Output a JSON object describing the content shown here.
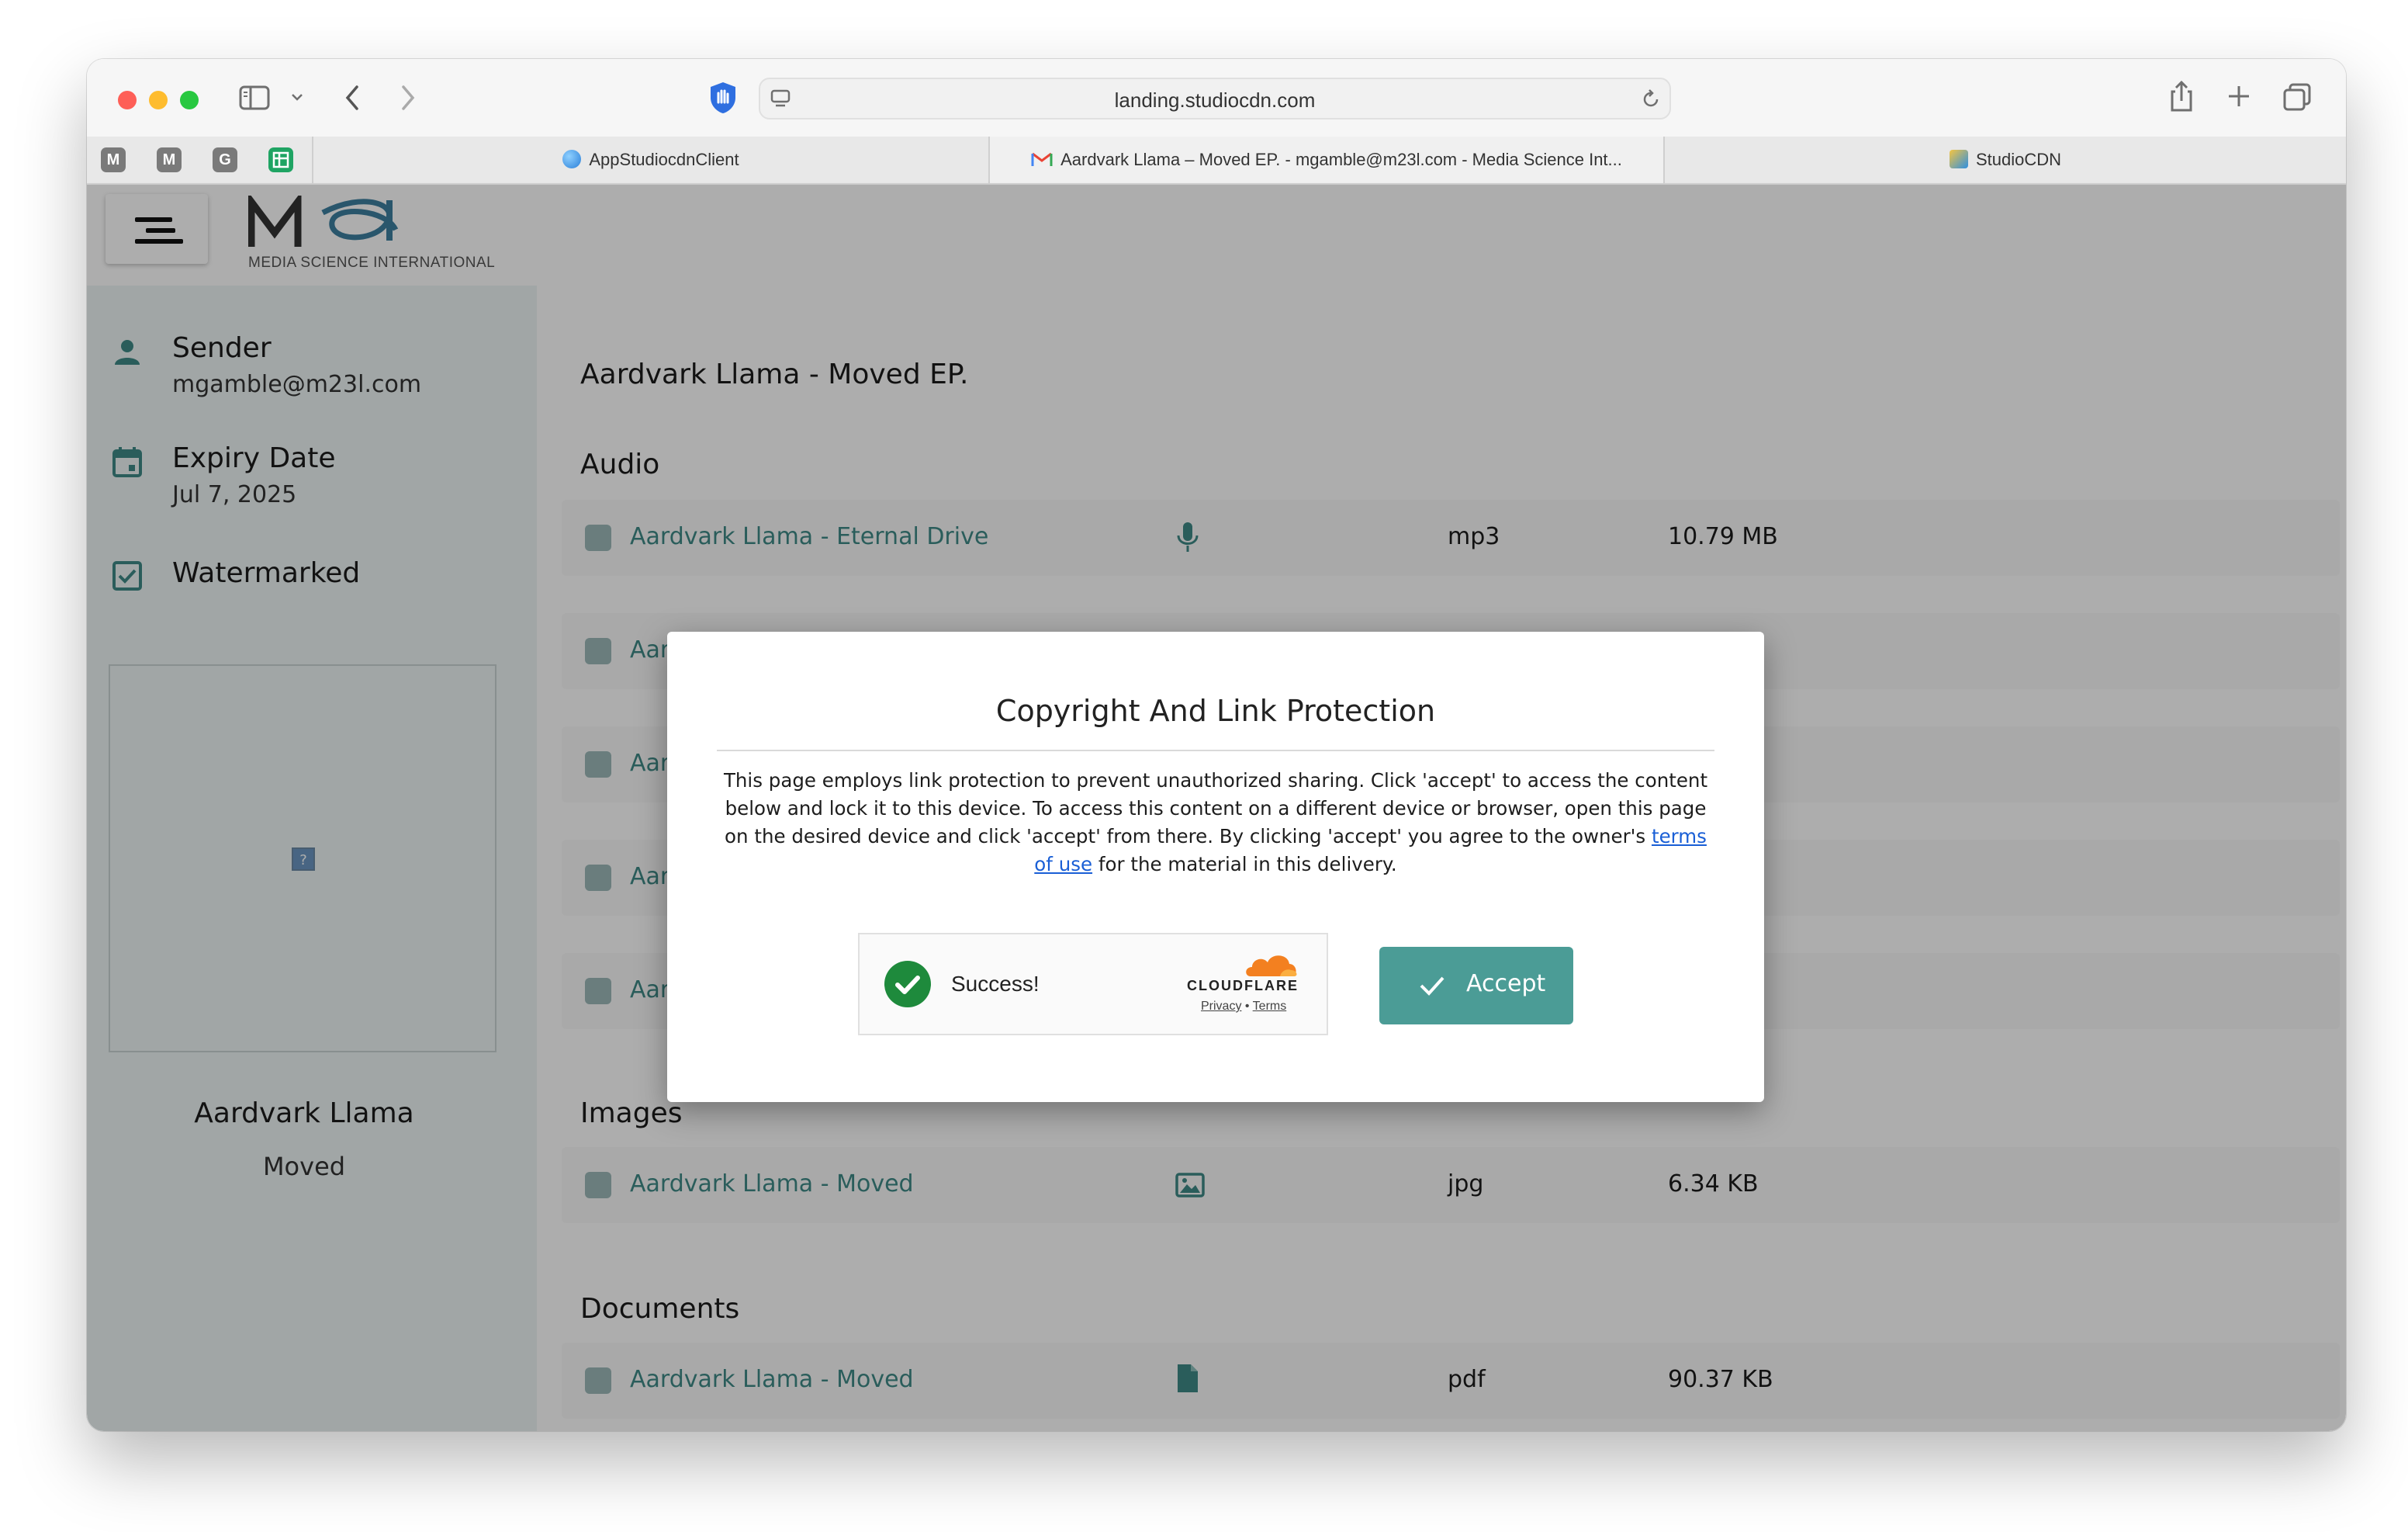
{
  "browser": {
    "url": "landing.studiocdn.com",
    "pinned_tabs": [
      {
        "icon": "gmail-icon",
        "letter": "M",
        "color": "#6c6c6c"
      },
      {
        "icon": "gmail-icon",
        "letter": "M",
        "color": "#6c6c6c"
      },
      {
        "icon": "google-icon",
        "letter": "G",
        "color": "#6c6c6c"
      },
      {
        "icon": "sheets-icon",
        "letter": "",
        "color": "#1fa463"
      }
    ],
    "tabs": [
      {
        "label": "AppStudiocdnClient",
        "icon": "globe-icon"
      },
      {
        "label": "Aardvark Llama – Moved EP. - mgamble@m23l.com - Media Science Int...",
        "icon": "gmail-icon",
        "active": true
      },
      {
        "label": "StudioCDN",
        "icon": "studiocdn-icon"
      }
    ]
  },
  "app": {
    "logo_text": "MEDIA SCIENCE INTERNATIONAL",
    "accent_color": "#4b9c96",
    "link_color": "#3f8a86"
  },
  "sidebar": {
    "sender_label": "Sender",
    "sender_value": "mgamble@m23l.com",
    "expiry_label": "Expiry Date",
    "expiry_value": "Jul 7, 2025",
    "watermarked_label": "Watermarked",
    "thumbnail_placeholder": "?",
    "artist": "Aardvark Llama",
    "release": "Moved"
  },
  "main": {
    "delivery_title": "Aardvark Llama - Moved EP.",
    "audio_heading": "Audio",
    "audio_files": [
      {
        "name": "Aardvark Llama - Eternal Drive",
        "type": "mp3",
        "size": "10.79 MB"
      },
      {
        "name": "Aarc",
        "type": "",
        "size": ""
      },
      {
        "name": "Aarc",
        "type": "",
        "size": ""
      },
      {
        "name": "Aarc",
        "type": "",
        "size": ""
      },
      {
        "name": "Aarc",
        "type": "",
        "size": ""
      }
    ],
    "images_heading": "Images",
    "image_files": [
      {
        "name": "Aardvark Llama - Moved",
        "type": "jpg",
        "size": "6.34 KB"
      }
    ],
    "documents_heading": "Documents",
    "document_files": [
      {
        "name": "Aardvark Llama - Moved",
        "type": "pdf",
        "size": "90.37 KB"
      }
    ]
  },
  "modal": {
    "title": "Copyright And Link Protection",
    "body_part1": "This page employs link protection to prevent unauthorized sharing. Click 'accept' to access the content below and lock it to this device. To access this content on a different device or browser, open this page on the desired device and click 'accept' from there. By clicking 'accept' you agree to the owner's",
    "terms_link": "terms of use",
    "body_part2": "for the material in this delivery.",
    "captcha_status": "Success!",
    "captcha_brand": "CLOUDFLARE",
    "captcha_privacy": "Privacy",
    "captcha_separator": "•",
    "captcha_terms": "Terms",
    "accept_label": "Accept"
  }
}
